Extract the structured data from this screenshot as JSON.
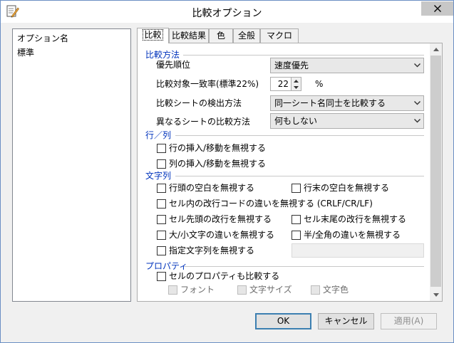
{
  "window": {
    "title": "比較オプション"
  },
  "left_list": {
    "header": "オプション名",
    "items": [
      "標準"
    ]
  },
  "tabs": [
    "比較",
    "比較結果",
    "色",
    "全般",
    "マクロ"
  ],
  "compare": {
    "section_method": "比較方法",
    "priority_label": "優先順位",
    "priority_value": "速度優先",
    "match_rate_label": "比較対象一致率(標準22%)",
    "match_rate_value": "22",
    "match_rate_unit": "%",
    "sheet_detect_label": "比較シートの検出方法",
    "sheet_detect_value": "同一シート名同士を比較する",
    "diff_sheet_label": "異なるシートの比較方法",
    "diff_sheet_value": "何もしない",
    "section_rowcol": "行／列",
    "ignore_row_insert": "行の挿入/移動を無視する",
    "ignore_col_insert": "列の挿入/移動を無視する",
    "section_string": "文字列",
    "ignore_leading_space": "行頭の空白を無視する",
    "ignore_trailing_space": "行末の空白を無視する",
    "ignore_newline_code": "セル内の改行コードの違いを無視する (CRLF/CR/LF)",
    "ignore_cell_leading_newline": "セル先頭の改行を無視する",
    "ignore_cell_trailing_newline": "セル末尾の改行を無視する",
    "ignore_case": "大/小文字の違いを無視する",
    "ignore_width": "半/全角の違いを無視する",
    "ignore_specified_string": "指定文字列を無視する",
    "section_property": "プロパティ",
    "compare_cell_property": "セルのプロパティも比較する",
    "prop_font": "フォント",
    "prop_size": "文字サイズ",
    "prop_color": "文字色"
  },
  "buttons": {
    "ok": "OK",
    "cancel": "キャンセル",
    "apply": "適用(A)"
  }
}
